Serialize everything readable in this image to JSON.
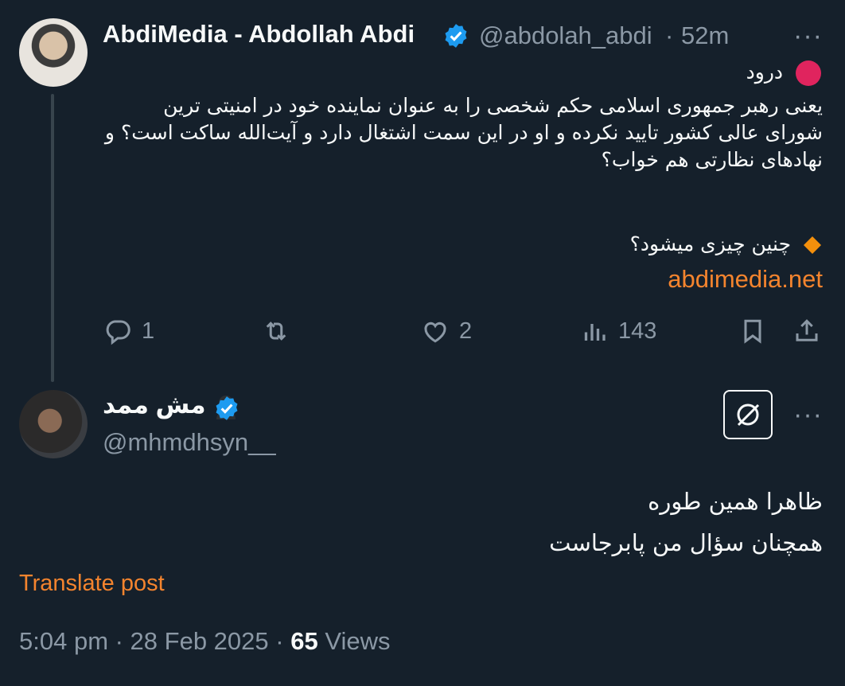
{
  "parent_tweet": {
    "author_name": "AbdiMedia - Abdollah Abdi",
    "handle": "@abdolah_abdi",
    "separator": "·",
    "time": "52m",
    "more_label": "···",
    "greeting": "درود",
    "body_lines": [
      "یعنی رهبر جمهوری اسلامی حکم شخصی را به عنوان نماینده خود در امنیتی ترین",
      "شورای عالی کشور تایید نکرده و او در این سمت اشتغال دارد و آیت‌الله ساکت است؟ و",
      "نهادهای نظارتی هم خواب؟"
    ],
    "question": "چنین چیزی میشود؟",
    "link": "abdimedia.net",
    "reply_count": "1",
    "like_count": "2",
    "view_count": "143"
  },
  "reply_tweet": {
    "author_name": "مش ممد",
    "handle": "@mhmdhsyn__",
    "more_label": "···",
    "body_lines": [
      "ظاهرا همین طوره",
      "همچنان سؤال من پابرجاست"
    ],
    "translate_label": "Translate post",
    "timestamp": "5:04 pm · 28 Feb 2025 ·",
    "views_count": "65",
    "views_label": "Views"
  },
  "colors": {
    "background": "#15202b",
    "accent_orange": "#f4842e",
    "verified_blue": "#1d9bf0",
    "muted_text": "#8b98a5",
    "red_circle": "#e0245e"
  },
  "icons": [
    "verified-icon",
    "more-icon",
    "red-circle-icon",
    "orange-diamond-icon",
    "reply-icon",
    "retweet-icon",
    "like-icon",
    "views-icon",
    "bookmark-icon",
    "share-icon",
    "grok-icon",
    "ninja-icon"
  ]
}
